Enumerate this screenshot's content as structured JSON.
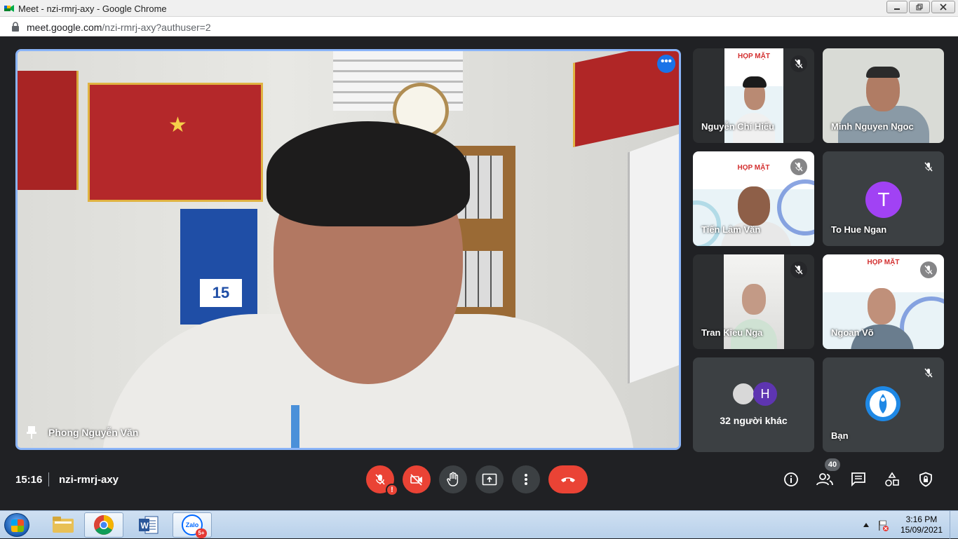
{
  "browser": {
    "tab_title": "Meet - nzi-rmrj-axy - Google Chrome",
    "url_host": "meet.google.com",
    "url_path": "/nzi-rmrj-axy?authuser=2"
  },
  "main_speaker": {
    "name": "Phong Nguyễn Văn",
    "calendar_number": "15"
  },
  "participants": [
    {
      "name": "Nguyễn Chí Hiếu",
      "muted": true
    },
    {
      "name": "Minh Nguyen Ngoc",
      "muted": false
    },
    {
      "name": "Tiến Lâm Văn",
      "muted": true
    },
    {
      "name": "To Hue Ngan",
      "muted": true,
      "avatar_letter": "T",
      "avatar_color": "#a142f4"
    },
    {
      "name": "Tran Kieu Nga",
      "muted": true
    },
    {
      "name": "Ngoan Võ",
      "muted": true
    }
  ],
  "others_tile": {
    "label": "32 người khác",
    "avatar_letter": "H"
  },
  "self_tile": {
    "name": "Bạn",
    "muted": true
  },
  "poster_text": {
    "headline": "HỌP MẶT"
  },
  "bottom_bar": {
    "time": "15:16",
    "meeting_code": "nzi-rmrj-axy",
    "participants_count": "40",
    "mic_alert": "!"
  },
  "taskbar": {
    "time": "3:16 PM",
    "date": "15/09/2021",
    "zalo_label": "Zalo",
    "zalo_badge": "5+"
  },
  "colors": {
    "meet_bg": "#202124",
    "accent_blue": "#1a73e8",
    "active_border": "#8ab4f8",
    "end_call_red": "#ea4335"
  }
}
